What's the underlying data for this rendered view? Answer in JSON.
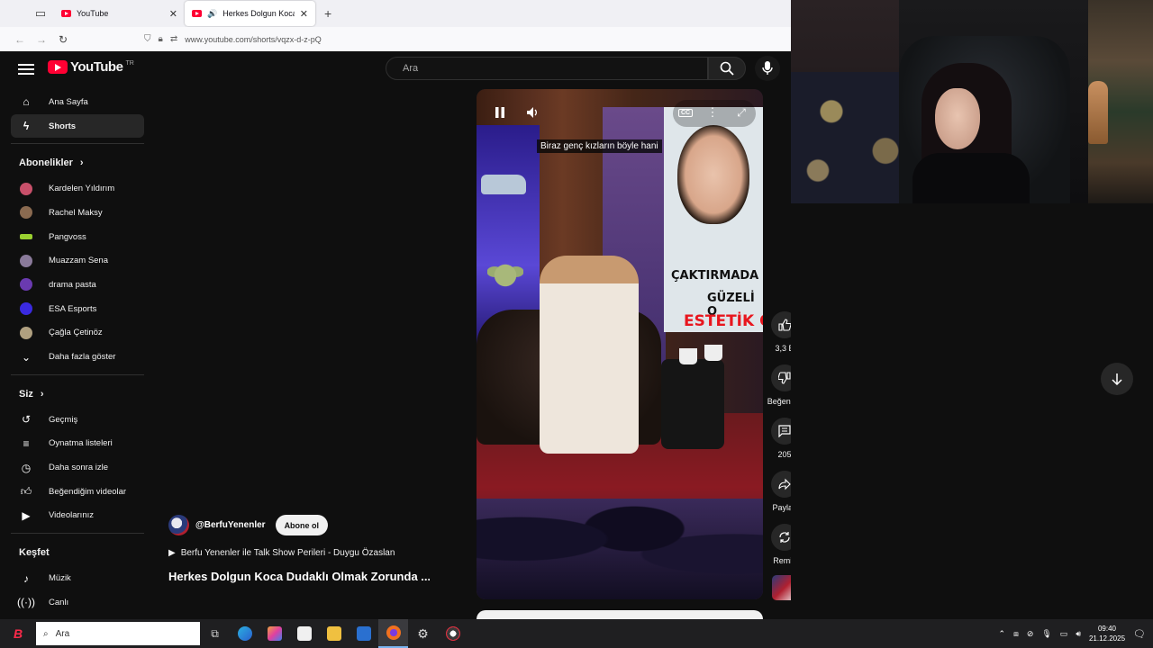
{
  "browser": {
    "tabs": [
      {
        "title": "YouTube",
        "active": false
      },
      {
        "title": "Herkes Dolgun Koca Dudaklı",
        "active": true
      }
    ],
    "url": "www.youtube.com/shorts/vqzx-d-z-pQ"
  },
  "masthead": {
    "logo_text": "YouTube",
    "logo_region": "TR",
    "search_placeholder": "Ara"
  },
  "sidebar": {
    "main": [
      {
        "label": "Ana Sayfa",
        "icon": "home-icon"
      },
      {
        "label": "Shorts",
        "icon": "shorts-icon",
        "active": true
      }
    ],
    "subscriptions_title": "Abonelikler",
    "subscriptions": [
      {
        "label": "Kardelen Yıldırım",
        "color": "#c8506a"
      },
      {
        "label": "Rachel Maksy",
        "color": "#8a6a50"
      },
      {
        "label": "Pangvoss",
        "color": "#9ad030"
      },
      {
        "label": "Muazzam Sena",
        "color": "#8a7a9a"
      },
      {
        "label": "drama pasta",
        "color": "#6a3ab0"
      },
      {
        "label": "ESA Esports",
        "color": "#3a2ae0"
      },
      {
        "label": "Çağla Çetinöz",
        "color": "#b0a080"
      },
      {
        "label": "Daha fazla göster",
        "icon": "chevron-down-icon"
      }
    ],
    "you_title": "Siz",
    "you": [
      {
        "label": "Geçmiş",
        "icon": "history-icon"
      },
      {
        "label": "Oynatma listeleri",
        "icon": "playlist-icon"
      },
      {
        "label": "Daha sonra izle",
        "icon": "clock-icon"
      },
      {
        "label": "Beğendiğim videolar",
        "icon": "like-icon"
      },
      {
        "label": "Videolarınız",
        "icon": "video-icon"
      }
    ],
    "explore_title": "Keşfet",
    "explore": [
      {
        "label": "Müzik",
        "icon": "music-icon"
      },
      {
        "label": "Canlı",
        "icon": "live-icon"
      }
    ]
  },
  "short": {
    "caption": "Biraz genç kızların böyle hani",
    "poster_text": [
      "ÇAKTIRMADA",
      "GÜZELİ O",
      "ESTETİK O"
    ],
    "channel": "@BerfuYenenler",
    "subscribe_label": "Abone ol",
    "playlist": "Berfu Yenenler ile Talk Show Perileri - Duygu Özaslan",
    "title": "Herkes Dolgun Koca Dudaklı Olmak Zorunda ..."
  },
  "actions": {
    "likes": "3,3 B",
    "dislike_label": "Beğenme",
    "comments": "205",
    "share_label": "Paylaş",
    "remix_label": "Remix"
  },
  "taskbar": {
    "start_text": "B",
    "search_text": "Ara",
    "time": "09:40",
    "date": "21.12.2025"
  }
}
